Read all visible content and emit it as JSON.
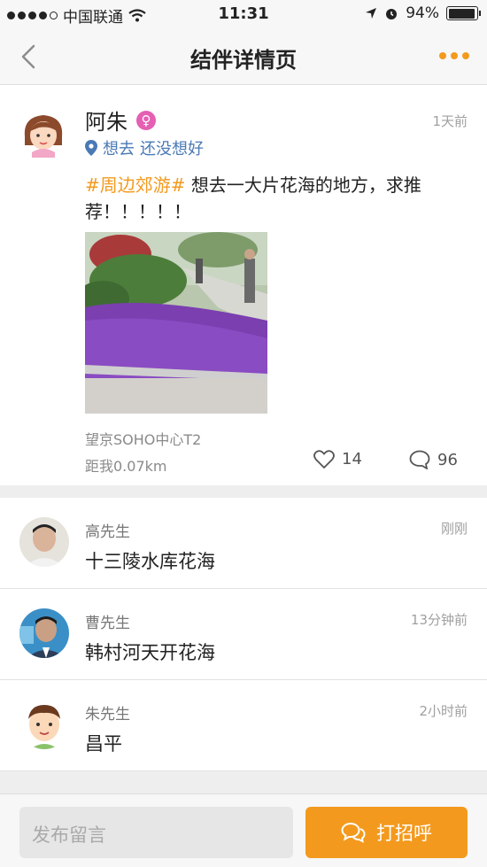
{
  "status_bar": {
    "carrier": "中国联通",
    "time": "11:31",
    "battery": "94%",
    "battery_level": 0.94
  },
  "header": {
    "title": "结伴详情页",
    "back_icon": "chevron-left-icon",
    "more_icon": "more-dots-icon",
    "accent_color": "#f39a1e"
  },
  "post": {
    "author": "阿朱",
    "gender_symbol": "♀",
    "time": "1天前",
    "intent_label": "想去",
    "intent_value": "还没想好",
    "topic": "#周边郊游#",
    "text": "想去一大片花海的地方，求推荐！！！！！",
    "location": "望京SOHO中心T2",
    "distance": "距我0.07km",
    "likes": "14",
    "comments": "96"
  },
  "comments": [
    {
      "name": "高先生",
      "time": "刚刚",
      "text": "十三陵水库花海"
    },
    {
      "name": "曹先生",
      "time": "13分钟前",
      "text": "韩村河天开花海"
    },
    {
      "name": "朱先生",
      "time": "2小时前",
      "text": "昌平"
    }
  ],
  "bottom_bar": {
    "input_placeholder": "发布留言",
    "greet_label": "打招呼"
  }
}
